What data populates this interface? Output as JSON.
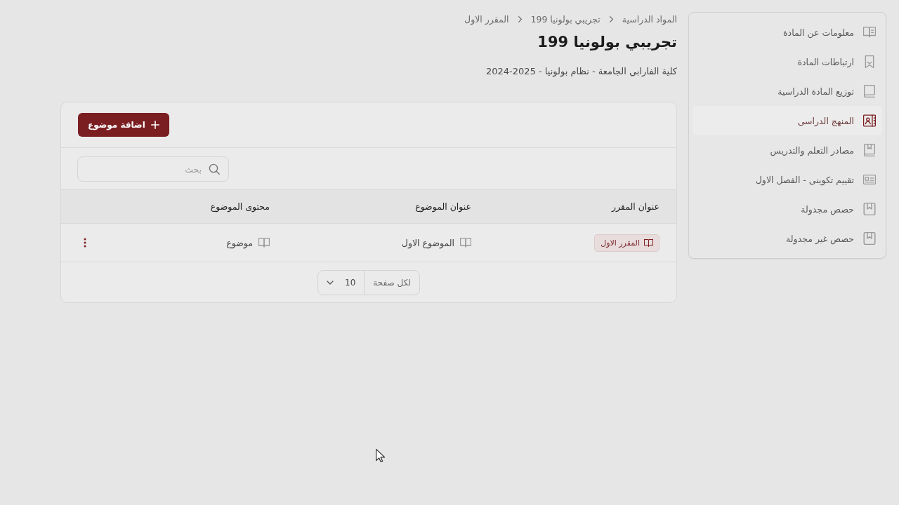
{
  "sidebar": {
    "items": [
      {
        "label": "معلومات عن المادة",
        "selected": false
      },
      {
        "label": "ارتباطات المادة",
        "selected": false
      },
      {
        "label": "توزيع المادة الدراسية",
        "selected": false
      },
      {
        "label": "المنهج الدراسى",
        "selected": true
      },
      {
        "label": "مصادر التعلم والتدريس",
        "selected": false
      },
      {
        "label": "تقييم تكوينى - الفصل الاول",
        "selected": false
      },
      {
        "label": "حصص مجدولة",
        "selected": false
      },
      {
        "label": "حصص غير مجدولة",
        "selected": false
      }
    ]
  },
  "breadcrumb": [
    "المواد الدراسية",
    "تجريبي بولونيا 199",
    "المقرر الاول"
  ],
  "page_title": "تجريبي بولونيا 199",
  "subtitle": "كلية الفارابي الجامعة - نظام بولونيا - 2025-2024",
  "toolbar": {
    "add_button": "اضافة موضوع"
  },
  "search": {
    "placeholder": "بحث"
  },
  "table": {
    "columns": [
      "عنوان المقرر",
      "عنوان الموضوع",
      "محتوى الموضوع"
    ],
    "rows": [
      {
        "course": "المقرر الاول",
        "topic": "الموضوع الاول",
        "content": "موضوع"
      }
    ]
  },
  "pagination": {
    "label": "لكل صفحة",
    "page_size": "10"
  }
}
